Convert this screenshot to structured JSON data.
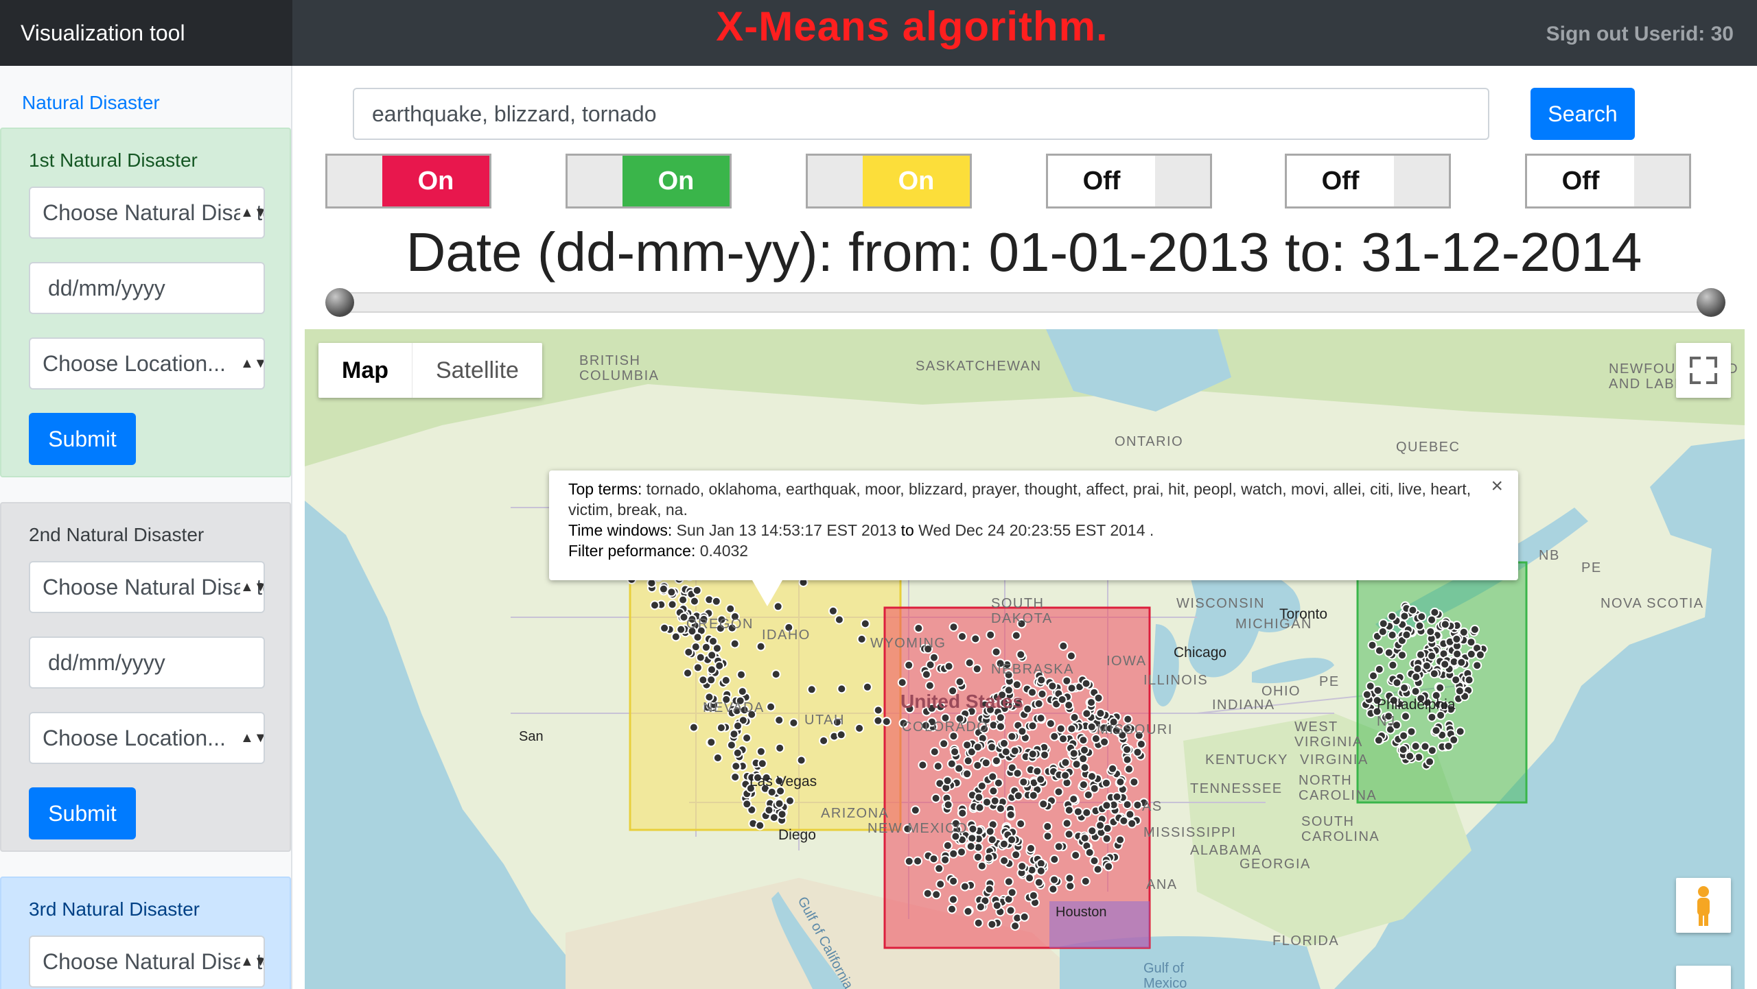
{
  "header": {
    "brand": "Visualization tool",
    "title": "X-Means algorithm.",
    "signout": "Sign out Userid: 30"
  },
  "sidebar": {
    "heading": "Natural Disaster",
    "cards": [
      {
        "title": "1st Natural Disaster",
        "disaster_select": "Choose Natural Disaster",
        "date_placeholder": "dd/mm/yyyy",
        "location_select": "Choose Location...",
        "submit": "Submit"
      },
      {
        "title": "2nd Natural Disaster",
        "disaster_select": "Choose Natural Disaster",
        "date_placeholder": "dd/mm/yyyy",
        "location_select": "Choose Location...",
        "submit": "Submit"
      },
      {
        "title": "3rd Natural Disaster",
        "disaster_select": "Choose Natural Disaster"
      }
    ]
  },
  "search": {
    "value": "earthquake, blizzard, tornado",
    "button": "Search"
  },
  "toggles": [
    {
      "label": "On",
      "state": "on",
      "color": "#e8174d"
    },
    {
      "label": "On",
      "state": "on",
      "color": "#3ab54a"
    },
    {
      "label": "On",
      "state": "on",
      "color": "#fcde3a"
    },
    {
      "label": "Off",
      "state": "off",
      "color": "#ffffff"
    },
    {
      "label": "Off",
      "state": "off",
      "color": "#ffffff"
    },
    {
      "label": "Off",
      "state": "off",
      "color": "#ffffff"
    }
  ],
  "date_range": {
    "text": "Date (dd-mm-yy): from: 01-01-2013 to: 31-12-2014",
    "from": "01-01-2013",
    "to": "31-12-2014",
    "slider_start": 0,
    "slider_end": 1
  },
  "map": {
    "type_buttons": [
      "Map",
      "Satellite"
    ],
    "active_type": "Map",
    "labels": [
      "BRITISH\nCOLUMBIA",
      "SASKATCHEWAN",
      "ONTARIO",
      "QUEBEC",
      "NEWFOUNDLAND\nAND LABRADOR",
      "NB",
      "PE",
      "NOVA SCOTIA",
      "OREGON",
      "IDAHO",
      "WYOMING",
      "SOUTH\nDAKOTA",
      "WISCONSIN",
      "MICHIGAN",
      "Toronto",
      "NEBRASKA",
      "IOWA",
      "Chicago",
      "ILLINOIS",
      "NEVADA",
      "UTAH",
      "United States",
      "COLORADO",
      "MISSOURI",
      "INDIANA",
      "OHIO",
      "PE",
      "Philadelphia",
      "San",
      "WEST\nVIRGINIA",
      "VIRGINIA",
      "KENTUCKY",
      "Las Vegas",
      "ARIZONA",
      "TENNESSEE",
      "NORTH\nCAROLINA",
      "Diego",
      "NEW MEXICO",
      "MISSISSIPPI",
      "SOUTH\nCAROLINA",
      "ALABAMA",
      "GEORGIA",
      "Gulf of California",
      "Houston",
      "Gulf of\nMexico",
      "FLORIDA",
      "NJ",
      "AS",
      "ANA"
    ],
    "cluster_colors": {
      "yellow": "#f6e26b",
      "red": "#ec5a6b",
      "green": "#48b84a"
    },
    "info_window": {
      "top_terms_label": "Top terms:",
      "top_terms": "tornado, oklahoma, earthquak, moor, blizzard, prayer, thought, affect, prai, hit, peopl, watch, movi, allei, citi, live, heart, victim, break, na.",
      "time_label": "Time windows:",
      "time_from": "Sun Jan 13 14:53:17 EST 2013",
      "time_to_word": "to",
      "time_to": "Wed Dec 24 20:23:55 EST 2014 .",
      "filter_label": "Filter peformance:",
      "filter_value": "0.4032",
      "close": "×"
    },
    "icons": [
      "fullscreen-icon",
      "pegman-icon"
    ]
  }
}
